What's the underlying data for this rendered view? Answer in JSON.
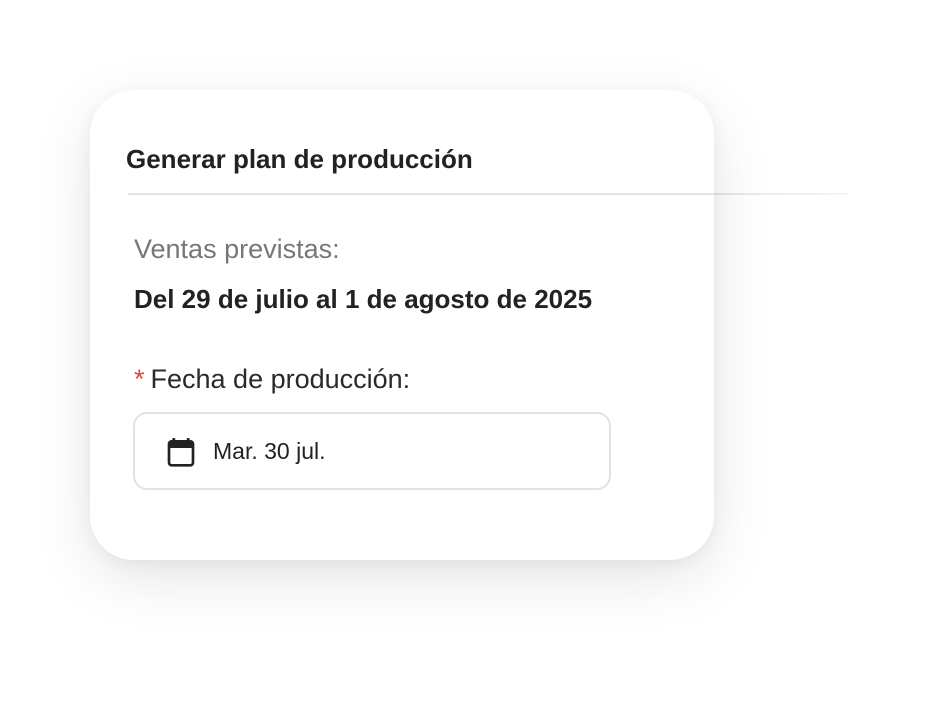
{
  "dialog": {
    "title": "Generar plan de producción",
    "forecast_label": "Ventas previstas:",
    "forecast_range": "Del 29 de julio al 1 de agosto de 2025",
    "required_marker": "*",
    "date_label": "Fecha de producción:",
    "date_value": "Mar. 30 jul.",
    "date_icon": "calendar-icon"
  },
  "colors": {
    "required": "#e0493b",
    "title_text": "#222222",
    "muted_text": "#777777",
    "border": "#e3e3e3"
  }
}
